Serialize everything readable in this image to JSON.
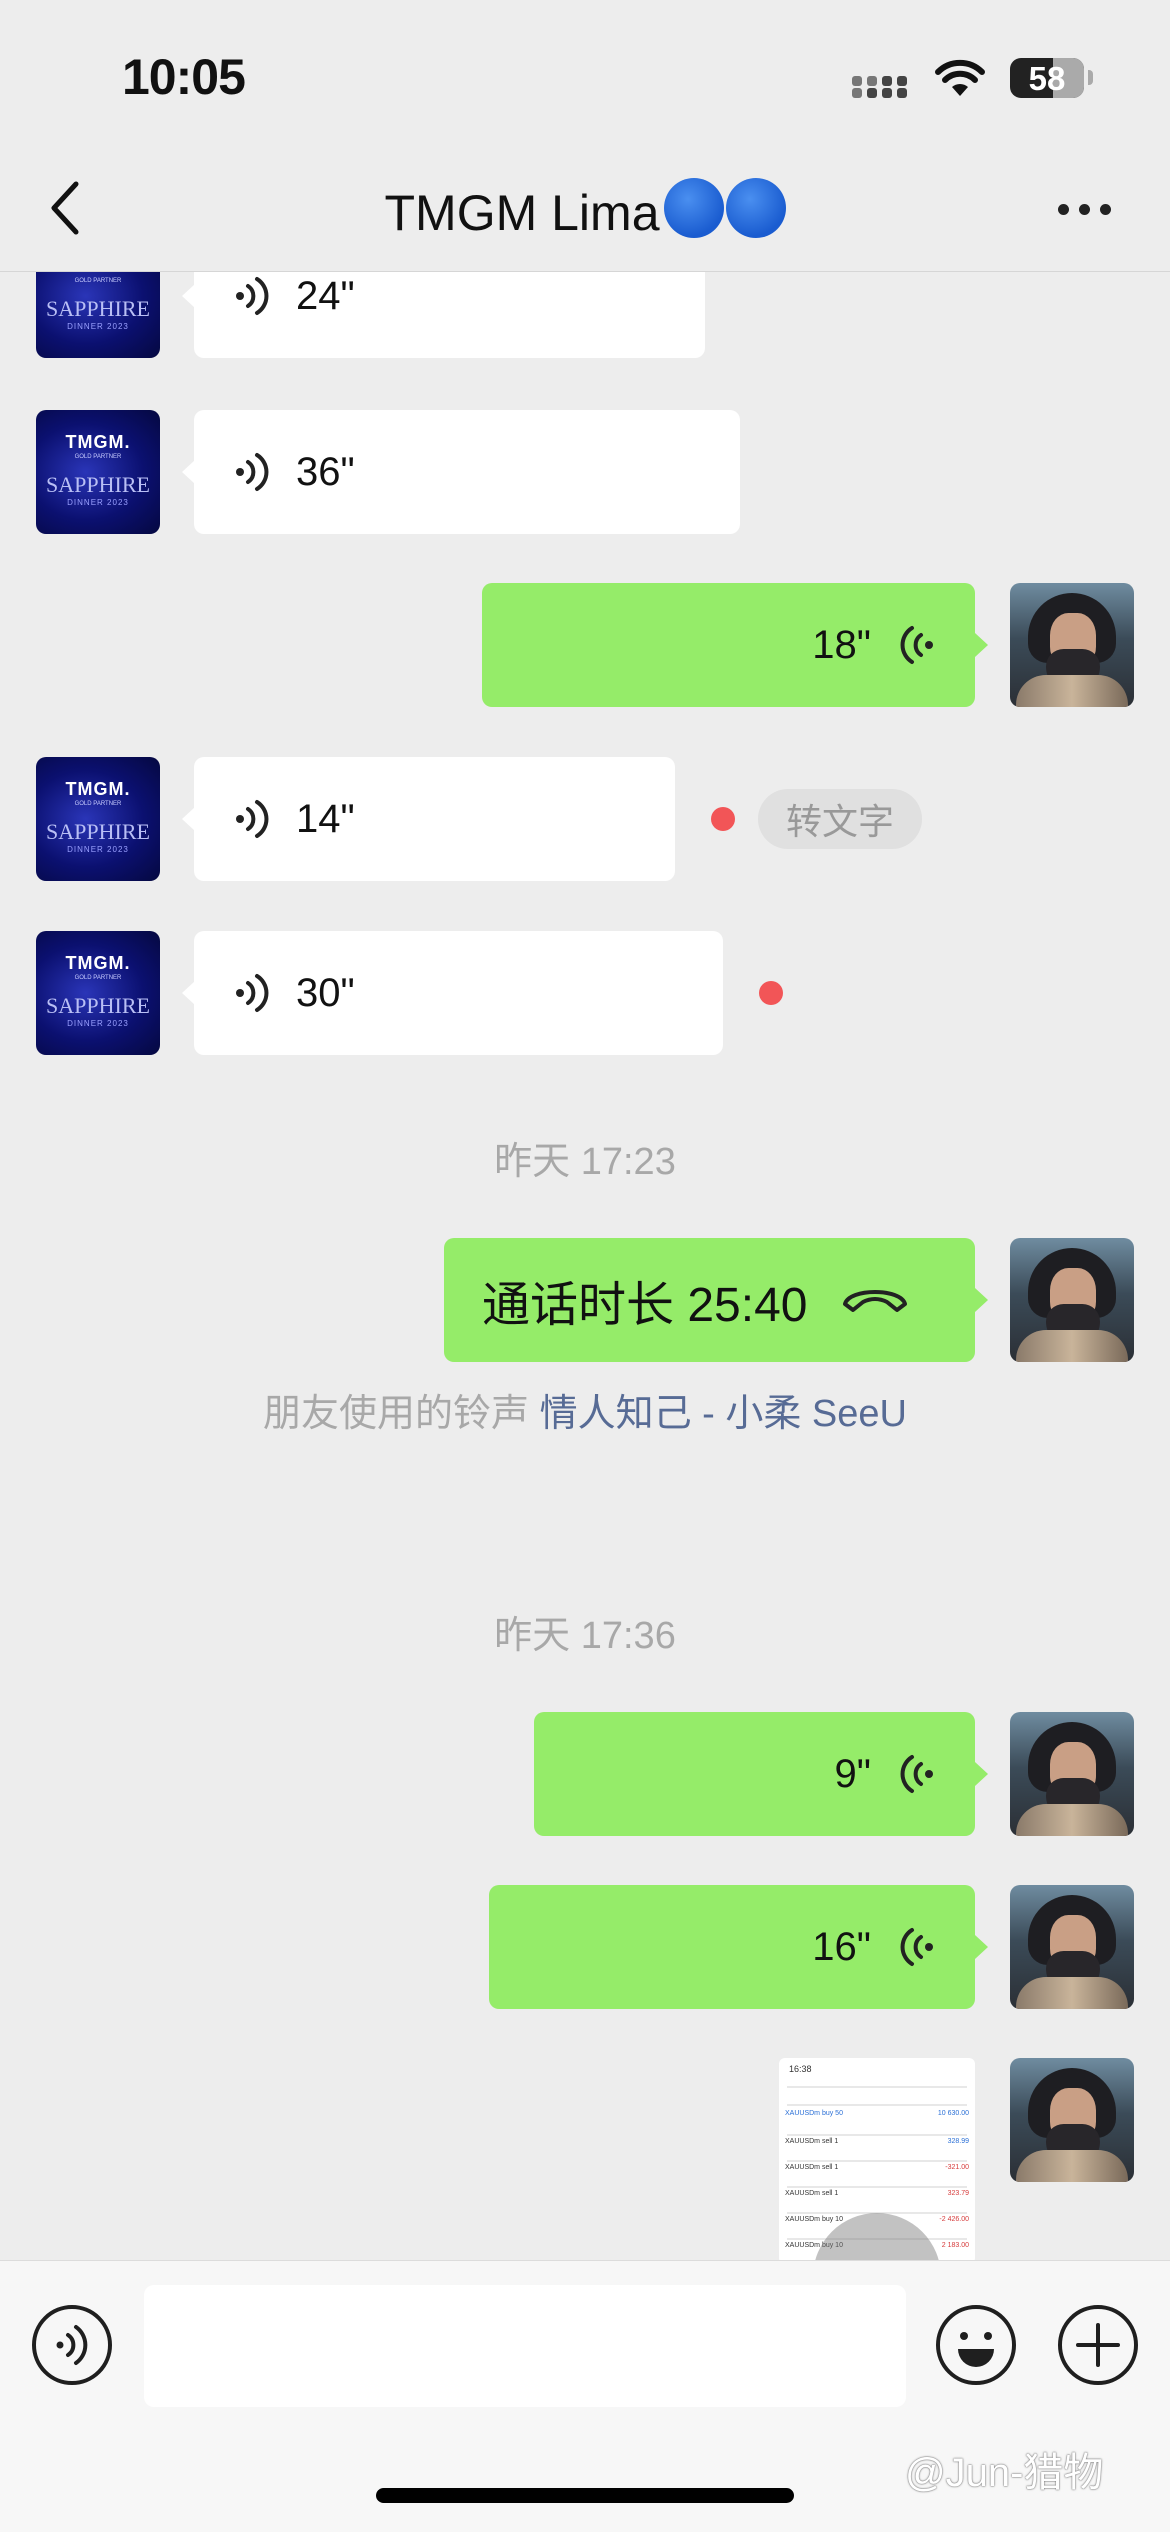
{
  "status_bar": {
    "time": "10:05",
    "battery": "58"
  },
  "nav": {
    "title": "TMGM Lima"
  },
  "messages": [
    {
      "side": "in",
      "duration": "24\""
    },
    {
      "side": "in",
      "duration": "36\""
    },
    {
      "side": "out",
      "duration": "18\""
    },
    {
      "side": "in",
      "duration": "14\"",
      "unread": true,
      "transcribe_label": "转文字"
    },
    {
      "side": "in",
      "duration": "30\"",
      "unread": true
    },
    {
      "timestamp": "昨天 17:23"
    },
    {
      "side": "out",
      "call_text": "通话时长 25:40"
    },
    {
      "system_prefix": "朋友使用的铃声 ",
      "system_song": "情人知己 - 小柔 SeeU"
    },
    {
      "timestamp": "昨天 17:36"
    },
    {
      "side": "out",
      "duration": "9\""
    },
    {
      "side": "out",
      "duration": "16\""
    },
    {
      "side": "out",
      "type": "image"
    }
  ],
  "tmgm_avatar": {
    "logo": "TMGM.",
    "partner": "GOLD PARTNER",
    "event": "SAPPHIRE",
    "dinner": "DINNER 2023"
  },
  "image_preview": {
    "time": "16:38",
    "rows": [
      {
        "left": "XAUUSDm buy 50",
        "right": "10 630.00"
      },
      {
        "left": "XAUUSDm sell 1",
        "right": "328.99"
      },
      {
        "left": "XAUUSDm sell 1",
        "right": "-321.00"
      },
      {
        "left": "XAUUSDm sell 1",
        "right": "323.79"
      },
      {
        "left": "XAUUSDm buy 10",
        "right": "-2 426.00"
      },
      {
        "left": "XAUUSDm buy 10",
        "right": "2 183.00"
      }
    ]
  },
  "watermark": "@Jun-猎物",
  "icons": [
    "back-chevron",
    "more-dots",
    "voice-wave",
    "phone",
    "emoji",
    "plus",
    "wifi",
    "signal"
  ]
}
